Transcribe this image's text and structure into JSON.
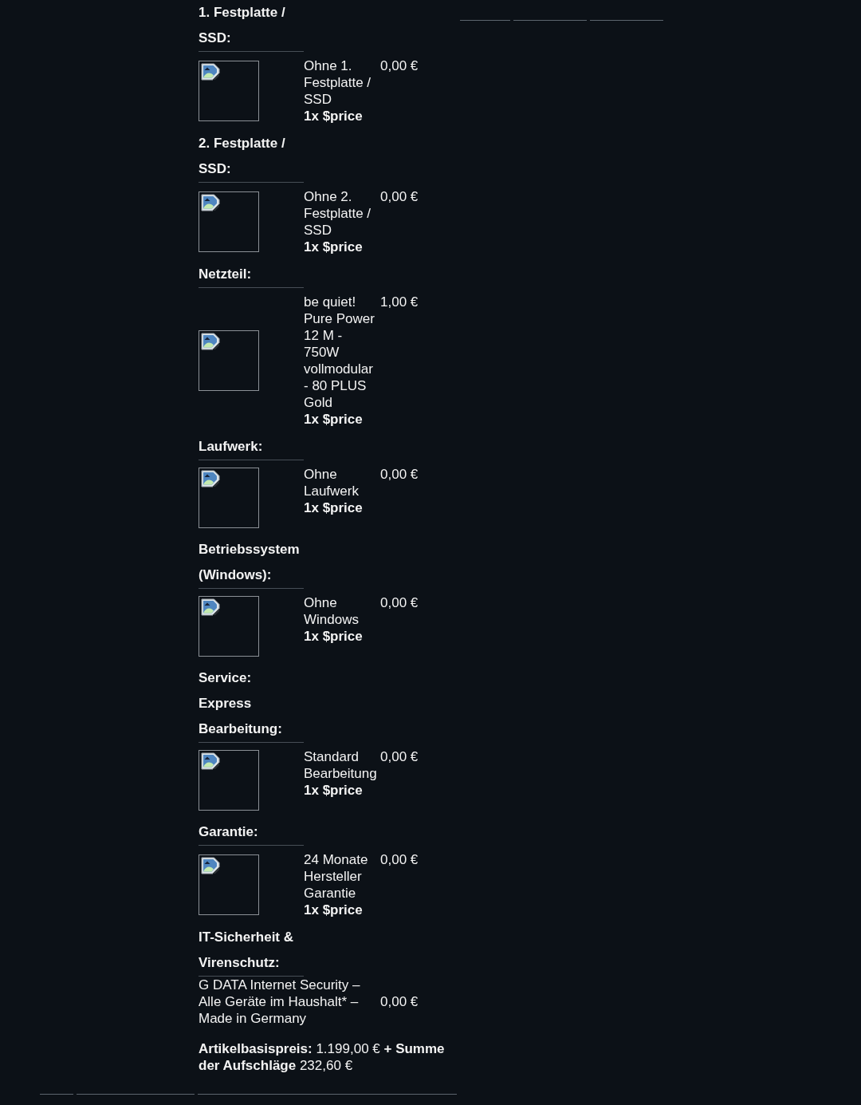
{
  "sections": [
    {
      "heading": "1. Festplatte / SSD:",
      "item": {
        "kind": "image",
        "name": "Ohne 1. Festplatte / SSD",
        "quantity": "1x $price",
        "price": "0,00 €"
      }
    },
    {
      "heading": "2. Festplatte / SSD:",
      "item": {
        "kind": "image",
        "name": "Ohne 2. Festplatte / SSD",
        "quantity": "1x $price",
        "price": "0,00 €"
      }
    },
    {
      "heading": "Netzteil:",
      "item": {
        "kind": "image",
        "name": "be quiet! Pure Power 12 M - 750W vollmodular - 80 PLUS Gold",
        "quantity": "1x $price",
        "price": "1,00 €"
      }
    },
    {
      "heading": "Laufwerk:",
      "item": {
        "kind": "image",
        "name": "Ohne Laufwerk",
        "quantity": "1x $price",
        "price": "0,00 €"
      }
    },
    {
      "heading": "Betriebssystem (Windows):",
      "item": {
        "kind": "image",
        "name": "Ohne Windows",
        "quantity": "1x $price",
        "price": "0,00 €"
      }
    },
    {
      "heading": "Service: Express Bearbeitung:",
      "item": {
        "kind": "image",
        "name": "Standard Bearbeitung",
        "quantity": "1x $price",
        "price": "0,00 €"
      }
    },
    {
      "heading": "Garantie:",
      "item": {
        "kind": "image",
        "name": "24 Monate Hersteller Garantie",
        "quantity": "1x $price",
        "price": "0,00 €"
      }
    },
    {
      "heading": "IT-Sicherheit & Virenschutz:",
      "item": {
        "kind": "plain",
        "name": "G DATA Internet Security – Alle Geräte im Haushalt* – Made in Germany",
        "price": "0,00 €"
      }
    }
  ],
  "summary": "**Artikelbasispreis:** 1.199,00 € **+ Summe der Aufschläge** 232,60 €"
}
